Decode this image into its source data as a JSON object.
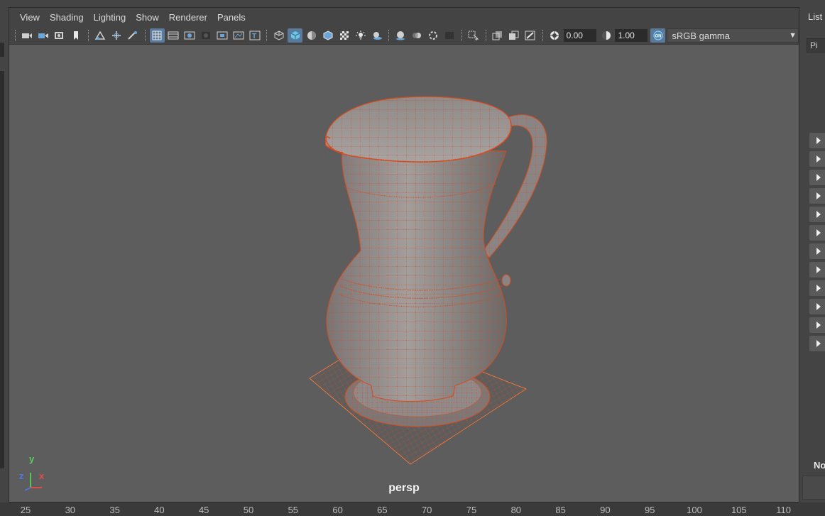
{
  "viewport": {
    "menus": [
      "View",
      "Shading",
      "Lighting",
      "Show",
      "Renderer",
      "Panels"
    ],
    "toolbar": {
      "exposure_value": "0.00",
      "gamma_value": "1.00",
      "color_space": "sRGB gamma"
    },
    "camera_label": "persp",
    "axis": {
      "y": "y",
      "z": "z",
      "x": "x"
    }
  },
  "right_panel": {
    "list_label": "List",
    "field_text": "Pi",
    "no_label": "No",
    "expander_count": 12
  },
  "timeline": {
    "ticks": [
      "25",
      "30",
      "35",
      "40",
      "45",
      "50",
      "55",
      "60",
      "65",
      "70",
      "75",
      "80",
      "85",
      "90",
      "95",
      "100",
      "105",
      "110"
    ]
  },
  "colors": {
    "viewport_bg": "#5d5d5d",
    "ui_bg": "#444444",
    "wire": "#d84b1e",
    "mesh": "#8a8584",
    "active_button": "#5a7a9c",
    "axis_x": "#e84a4a",
    "axis_y": "#58d058",
    "axis_z": "#4a78e8"
  },
  "icons": [
    "camera-icon",
    "grid-icon",
    "wireframe-icon",
    "smooth-shade-icon",
    "textured-icon",
    "lights-icon",
    "shadows-icon",
    "isolate-select-icon",
    "xray-icon",
    "exposure-icon",
    "gamma-icon",
    "color-management-icon"
  ]
}
